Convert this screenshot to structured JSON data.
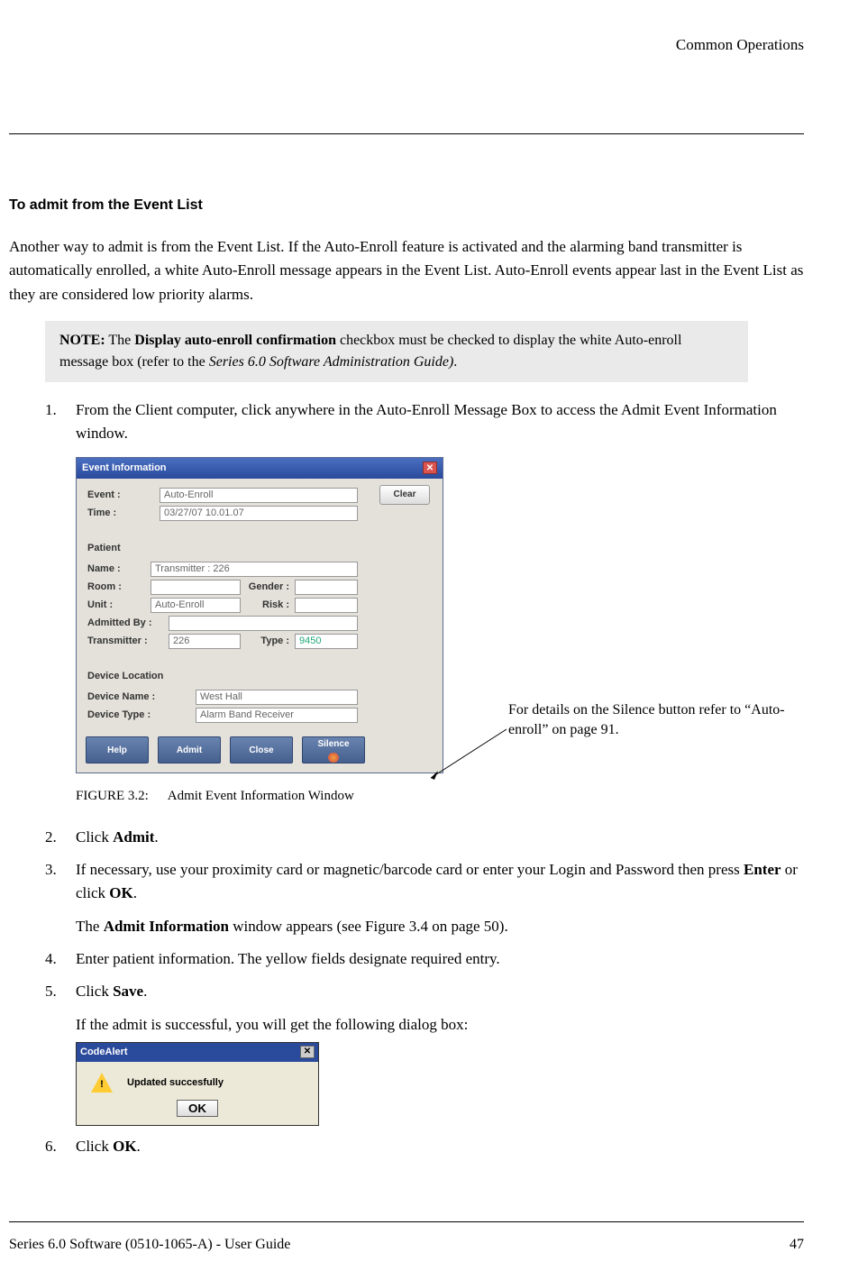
{
  "header": {
    "section": "Common Operations"
  },
  "title": "To admit from the Event List",
  "intro": "Another way to admit is from the Event List. If the Auto-Enroll feature is activated and the alarming band transmitter is automatically enrolled, a white Auto-Enroll message appears in the Event List. Auto-Enroll events appear last in the Event List as they are considered low priority alarms.",
  "note": {
    "lead": "NOTE:",
    "before_bold": " The ",
    "bold": "Display auto-enroll confirmation",
    "after_bold": " checkbox must be checked to display the white Auto-enroll message box (refer to the ",
    "ital": "Series 6.0 Software Administration Guide)",
    "tail": "."
  },
  "steps": {
    "s1": "From the Client computer, click anywhere in the Auto-Enroll Message Box to access the Admit Event Information window.",
    "s2a": "Click ",
    "s2b": "Admit",
    "s2c": ".",
    "s3a": "If necessary, use your proximity card or magnetic/barcode card or enter your Login and Password then press ",
    "s3b": "Enter",
    "s3c": " or click ",
    "s3d": "OK",
    "s3e": ".",
    "s3_sub_a": "The ",
    "s3_sub_b": "Admit Information",
    "s3_sub_c": " window appears (see Figure 3.4 on page 50).",
    "s4": "Enter patient information. The yellow fields designate required entry.",
    "s5a": "Click ",
    "s5b": "Save",
    "s5c": ".",
    "s5_sub": "If the admit is successful, you will get the following dialog box:",
    "s6a": "Click ",
    "s6b": "OK",
    "s6c": "."
  },
  "callout": "For details on the Silence button refer to “Auto-enroll” on page 91.",
  "fig": {
    "id": "FIGURE 3.2:",
    "caption": "Admit Event Information Window",
    "title": "Event Information",
    "clear": "Clear",
    "event_lbl": "Event :",
    "event_val": "Auto-Enroll",
    "time_lbl": "Time :",
    "time_val": "03/27/07 10.01.07",
    "patient_hdr": "Patient",
    "name_lbl": "Name :",
    "name_val": "Transmitter : 226",
    "room_lbl": "Room :",
    "gender_lbl": "Gender :",
    "unit_lbl": "Unit :",
    "unit_val": "Auto-Enroll",
    "risk_lbl": "Risk :",
    "adm_lbl": "Admitted By :",
    "tx_lbl": "Transmitter :",
    "tx_val": "226",
    "type_lbl": "Type :",
    "type_val": "9450",
    "loc_hdr": "Device Location",
    "dname_lbl": "Device Name :",
    "dname_val": "West Hall",
    "dtype_lbl": "Device Type :",
    "dtype_val": "Alarm Band Receiver",
    "help": "Help",
    "admit": "Admit",
    "close": "Close",
    "silence": "Silence"
  },
  "codealert": {
    "title": "CodeAlert",
    "msg": "Updated succesfully",
    "ok": "OK"
  },
  "footer": {
    "left": "Series 6.0 Software (0510-1065-A) - User Guide",
    "right": "47"
  }
}
